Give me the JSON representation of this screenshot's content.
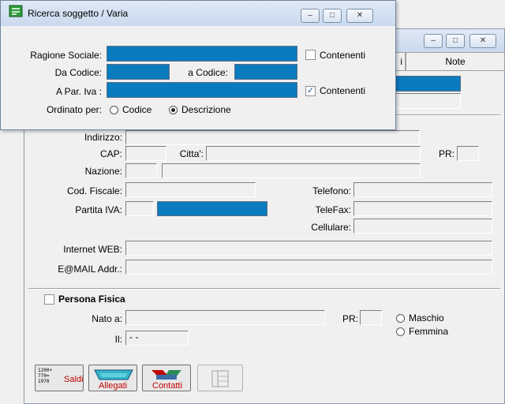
{
  "back_window": {
    "note_tab": "Note",
    "tab_partial": "i",
    "fields": {
      "indirizzo": "Indirizzo:",
      "cap": "CAP:",
      "citta": "Citta':",
      "pr": "PR:",
      "nazione": "Nazione:",
      "cod_fiscale": "Cod. Fiscale:",
      "telefono": "Telefono:",
      "partita_iva": "Partita IVA:",
      "telefax": "TeleFax:",
      "cellulare": "Cellulare:",
      "internet_web": "Internet WEB:",
      "email": "E@MAIL Addr.:"
    },
    "persona_fisica": {
      "label": "Persona Fisica",
      "nato_a": "Nato a:",
      "pr": "PR:",
      "il": "Il:",
      "il_value": "- -",
      "maschio": "Maschio",
      "femmina": "Femmina"
    },
    "buttons": {
      "saldi": "Saldi",
      "allegati": "Allegati",
      "contatti": "Contatti",
      "saldi_numbers": "1200+\n770=\n1970"
    }
  },
  "dialog": {
    "title": "Ricerca soggetto / Varia",
    "ragione_sociale": "Ragione Sociale:",
    "contenenti_1": "Contenenti",
    "da_codice": "Da Codice:",
    "a_codice": "a Codice:",
    "a_par_iva": "A Par. Iva :",
    "contenenti_2": "Contenenti",
    "ordinato_per": "Ordinato per:",
    "codice": "Codice",
    "descrizione": "Descrizione"
  },
  "colors": {
    "selected_field": "#0a7bbf",
    "titlebar": "#c9d9ee"
  }
}
